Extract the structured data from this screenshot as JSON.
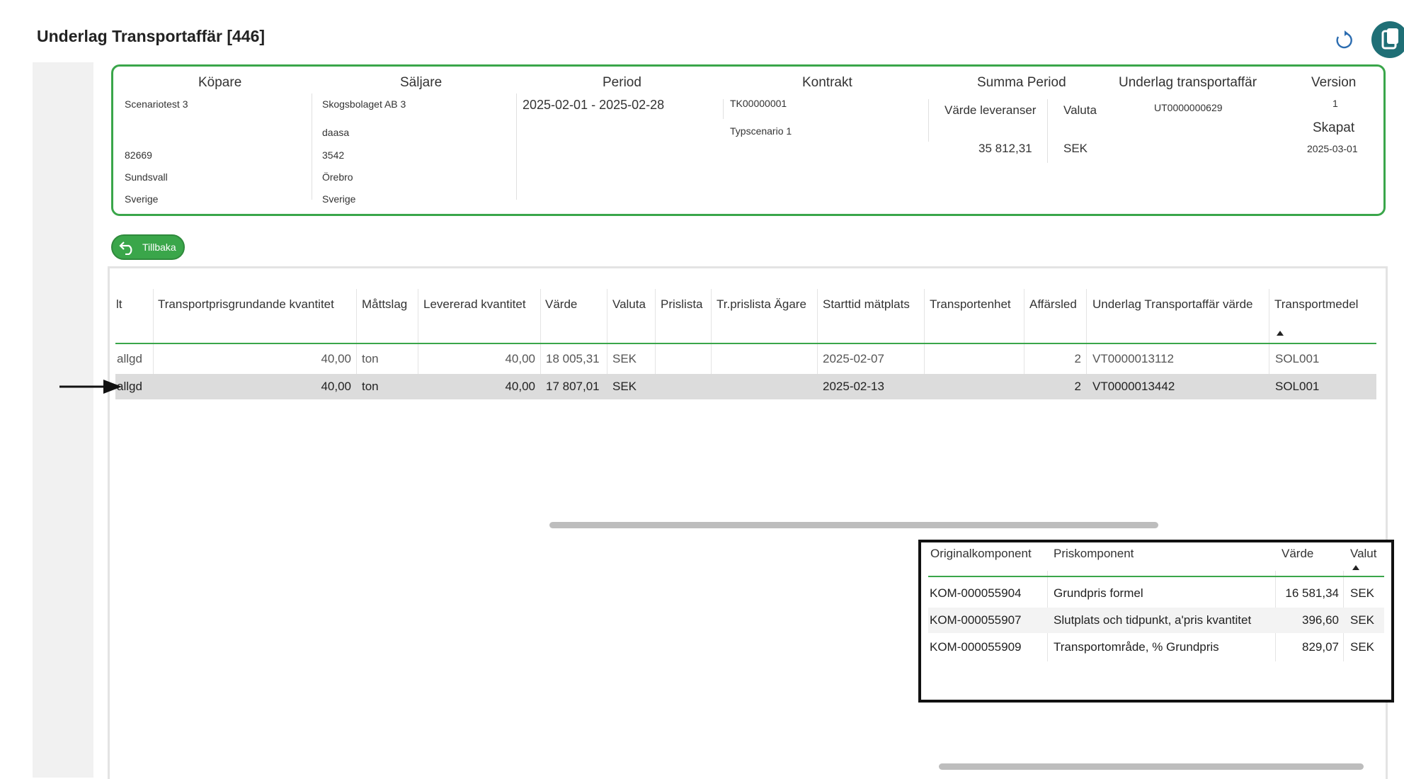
{
  "page": {
    "title": "Underlag Transportaffär [446]"
  },
  "header": {
    "kopare": {
      "label": "Köpare",
      "name": "Scenariotest 3",
      "postal_code": "82669",
      "city": "Sundsvall",
      "country": "Sverige"
    },
    "saljare": {
      "label": "Säljare",
      "name": "Skogsbolaget AB 3",
      "extra": "daasa",
      "postal_code": "3542",
      "city": "Örebro",
      "country": "Sverige"
    },
    "period": {
      "label": "Period",
      "value": "2025-02-01 - 2025-02-28"
    },
    "kontrakt": {
      "label": "Kontrakt",
      "number": "TK00000001",
      "scenario": "Typscenario 1"
    },
    "summa_period": {
      "label": "Summa Period",
      "varde_label": "Värde leveranser",
      "valuta_label": "Valuta",
      "varde": "35 812,31",
      "valuta": "SEK"
    },
    "underlag": {
      "label": "Underlag transportaffär",
      "value": "UT0000000629"
    },
    "version": {
      "label": "Version",
      "value": "1",
      "skapat_label": "Skapat",
      "skapat": "2025-03-01"
    }
  },
  "back_button": {
    "label": "Tillbaka"
  },
  "grid": {
    "columns": [
      "lt",
      "Transportprisgrundande kvantitet",
      "Måttslag",
      "Levererad kvantitet",
      "Värde",
      "Valuta",
      "Prislista",
      "Tr.prislista Ägare",
      "Starttid mätplats",
      "Transportenhet",
      "Affärsled",
      "Underlag Transportaffär värde",
      "Transportmedel"
    ],
    "rows": [
      {
        "c0": "allgd",
        "c1": "40,00",
        "c2": "ton",
        "c3": "40,00",
        "c4": "18 005,31",
        "c5": "SEK",
        "c6": "",
        "c7": "",
        "c8": "2025-02-07",
        "c9": "",
        "c10": "2",
        "c11": "VT0000013112",
        "c12": "SOL001"
      },
      {
        "c0": "allgd",
        "c1": "40,00",
        "c2": "ton",
        "c3": "40,00",
        "c4": "17 807,01",
        "c5": "SEK",
        "c6": "",
        "c7": "",
        "c8": "2025-02-13",
        "c9": "",
        "c10": "2",
        "c11": "VT0000013442",
        "c12": "SOL001"
      }
    ]
  },
  "sub_grid": {
    "columns": [
      "Originalkomponent",
      "Priskomponent",
      "Värde",
      "Valut"
    ],
    "rows": [
      {
        "c0": "KOM-000055904",
        "c1": "Grundpris formel",
        "c2": "16 581,34",
        "c3": "SEK"
      },
      {
        "c0": "KOM-000055907",
        "c1": "Slutplats och tidpunkt, a'pris kvantitet",
        "c2": "396,60",
        "c3": "SEK"
      },
      {
        "c0": "KOM-000055909",
        "c1": "Transportområde, % Grundpris",
        "c2": "829,07",
        "c3": "SEK"
      }
    ]
  },
  "colors": {
    "accent": "#3aa64a",
    "selected_row": "#dcdcdc",
    "app_button": "#1f6f76"
  }
}
